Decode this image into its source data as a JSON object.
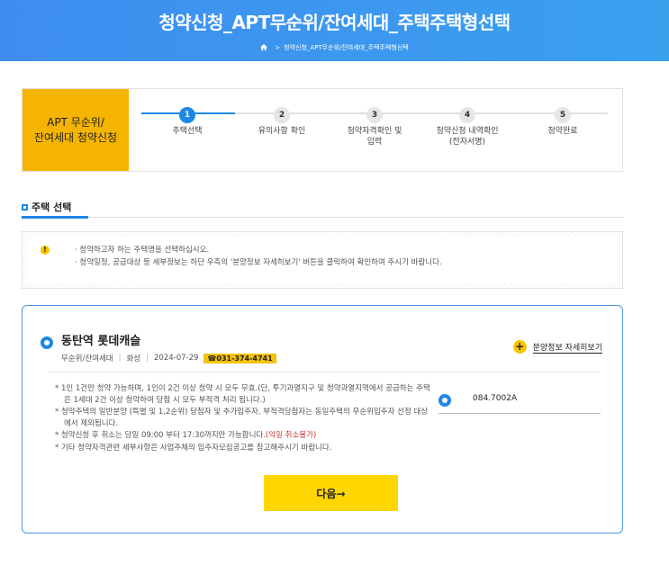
{
  "header": {
    "title": "청약신청_APT무순위/잔여세대_주택주택형선택",
    "breadcrumb_sep": ">",
    "breadcrumb_current": "청약신청_APT무순위/잔여세대_주택주택형선택"
  },
  "steps": {
    "badge_line1": "APT 무순위/",
    "badge_line2": "잔여세대 청약신청",
    "items": [
      {
        "num": "1",
        "label1": "주택선택",
        "label2": ""
      },
      {
        "num": "2",
        "label1": "유의사항 확인",
        "label2": ""
      },
      {
        "num": "3",
        "label1": "청약자격확인 및",
        "label2": "입력"
      },
      {
        "num": "4",
        "label1": "청약신청 내역확인",
        "label2": "(전자서명)"
      },
      {
        "num": "5",
        "label1": "청약완료",
        "label2": ""
      }
    ],
    "active_index": 0
  },
  "section": {
    "title": "주택 선택"
  },
  "notice": {
    "icon": "!",
    "lines": [
      "· 청약하고자 하는 주택명을 선택하십시오.",
      "· 청약일정, 공급대상 등 세부정보는 하단 우측의 '분양정보 자세히보기' 버튼을 클릭하여 확인하여 주시기 바랍니다."
    ]
  },
  "house": {
    "name": "동탄역 롯데캐슬",
    "type": "무순위/잔여세대",
    "region": "화성",
    "date": "2024-07-29",
    "phone": "☎031-374-4741",
    "detail_plus": "+",
    "detail_label": "분양정보 자세히보기",
    "bullets": [
      "* 1인 1건만 청약 가능하며, 1인이 2건 이상 청약 시 모두 무효.(단, 투기과열지구 및 청약과열지역에서 공급하는 주택은 1세대 2건 이상 청약하여 당첨 시 모두 부적격 처리 됩니다.)",
      "* 청약주택의 일반분양 (특별 및 1,2순위) 당첨자 및 추가입주자, 부적격당첨자는 동일주택의 무순위입주자 선정 대상에서 제외됩니다."
    ],
    "cancel_text": "* 청약신청 후 취소는 당일 09:00 부터 17:30까지만 가능합니다.",
    "cancel_red": "(익일 취소불가)",
    "last_bullet": "* 기타 청약자격관련 세부사항은 사업주체의 입주자모집공고를 참고해주시기 바랍니다.",
    "unit_type": "084.7002A",
    "next_label": "다음→"
  },
  "colors": {
    "brand": "#1e88e5",
    "accent": "#f4b400",
    "button": "#ffd600"
  }
}
